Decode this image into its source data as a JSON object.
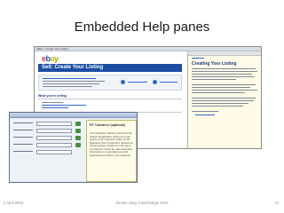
{
  "slide": {
    "title": "Embedded Help panes"
  },
  "ebay_window": {
    "window_title": "eBay > Create Your Listing",
    "logo": {
      "e": "e",
      "b": "b",
      "a": "a",
      "y": "y"
    },
    "banner": "Sell: Create Your Listing",
    "section_heading": "What you're selling",
    "help_pane": {
      "title": "Creating Your Listing"
    }
  },
  "dialog": {
    "help_pane": {
      "title": "RT Tolerance (optional)",
      "body": "This Ordination Solution constrains all feature identification (solid core) and selects an RT tolerance within an RT Retention Time Threshold if retained for all the features. Peaks from the same run wherein narrow the data. Extended information on peak alignment with optimized and match to the tolerance."
    }
  },
  "footer": {
    "date": "2 April 2016",
    "center": "Steven Jong, InterChange 2016",
    "page": "12"
  },
  "colors": {
    "ebay_banner": "#1b4ea2",
    "help_pane_bg": "#fffbe6",
    "dialog_bg": "#eef2f7"
  }
}
